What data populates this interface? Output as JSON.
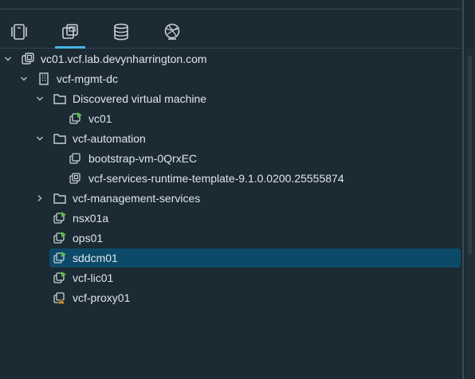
{
  "tabs": [
    {
      "name": "Hosts and Clusters",
      "icon": "hosts-clusters-icon",
      "active": false
    },
    {
      "name": "VMs and Templates",
      "icon": "vms-templates-icon",
      "active": true
    },
    {
      "name": "Storage",
      "icon": "storage-icon",
      "active": false
    },
    {
      "name": "Networking",
      "icon": "networking-icon",
      "active": false
    }
  ],
  "tree": {
    "vcenter": "vc01.vcf.lab.devynharrington.com",
    "datacenter": "vcf-mgmt-dc",
    "folder_discovered": "Discovered virtual machine",
    "vm_vc01": "vc01",
    "folder_automation": "vcf-automation",
    "vm_bootstrap": "bootstrap-vm-0QrxEC",
    "template_runtime": "vcf-services-runtime-template-9.1.0.0200.25555874",
    "folder_management_services": "vcf-management-services",
    "vm_nsx01a": "nsx01a",
    "vm_ops01": "ops01",
    "vm_sddcm01": "sddcm01",
    "vm_vcf_lic01": "vcf-lic01",
    "vm_vcf_proxy01": "vcf-proxy01"
  },
  "selected_item": "sddcm01",
  "colors": {
    "background": "#1b2a33",
    "selection": "#0d4a6a",
    "accent": "#48b4e0",
    "vm_running": "#5cc043",
    "vm_warning": "#f5a623"
  }
}
